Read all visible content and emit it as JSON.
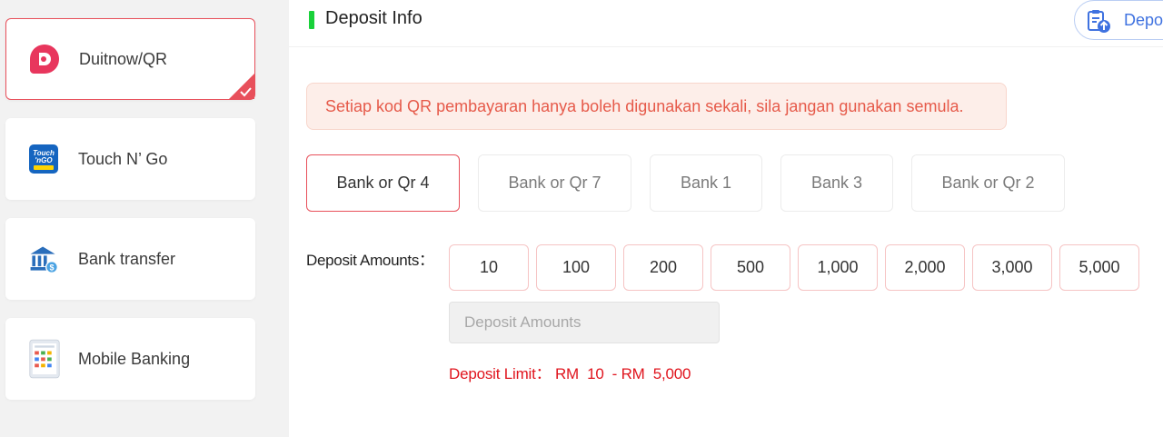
{
  "sidebar": {
    "methods": [
      {
        "label": "Duitnow/QR",
        "icon": "duitnow-icon",
        "selected": true
      },
      {
        "label": "Touch N’ Go",
        "icon": "touch-n-go-icon",
        "selected": false
      },
      {
        "label": "Bank transfer",
        "icon": "bank-icon",
        "selected": false
      },
      {
        "label": "Mobile Banking",
        "icon": "mobile-banking-icon",
        "selected": false
      }
    ]
  },
  "header": {
    "title": "Deposit Info",
    "deposit_button_label": "Deposit"
  },
  "notice": "Setiap kod QR pembayaran hanya boleh digunakan sekali, sila jangan gunakan semula.",
  "banks": [
    {
      "label": "Bank or Qr 4",
      "selected": true
    },
    {
      "label": "Bank or Qr 7",
      "selected": false
    },
    {
      "label": "Bank 1",
      "selected": false
    },
    {
      "label": "Bank 3",
      "selected": false
    },
    {
      "label": "Bank or Qr 2",
      "selected": false
    }
  ],
  "amounts": {
    "label": "Deposit Amounts：",
    "options": [
      "10",
      "100",
      "200",
      "500",
      "1,000",
      "2,000",
      "3,000",
      "5,000"
    ],
    "input_placeholder": "Deposit Amounts",
    "input_value": "",
    "limit_text": "Deposit Limit： RM  10  - RM  5,000"
  },
  "colors": {
    "accent_red": "#e8505b",
    "header_bar_green": "#19d13a",
    "notice_text": "#e65a4a",
    "limit_text": "#e0151e",
    "deposit_blue": "#3f72e0"
  }
}
